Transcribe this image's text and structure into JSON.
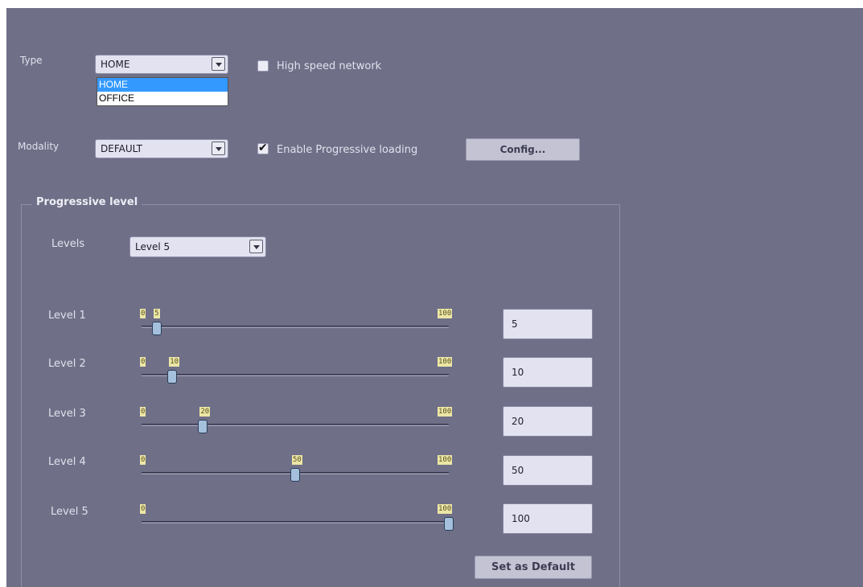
{
  "type": {
    "label": "Type",
    "value": "HOME",
    "options": [
      "HOME",
      "OFFICE"
    ],
    "highlighted": "HOME"
  },
  "high_speed": {
    "label": "High speed network",
    "checked": false
  },
  "modality": {
    "label": "Modality",
    "value": "DEFAULT"
  },
  "progressive_loading": {
    "label": "Enable Progressive loading",
    "checked": true
  },
  "config_button": "Config...",
  "group": {
    "title": "Progressive level",
    "levels_label": "Levels",
    "levels_value": "Level 5",
    "rows": [
      {
        "label": "Level 1",
        "min": 0,
        "max": 100,
        "value": 5,
        "min_text": "0",
        "max_text": "100",
        "value_text": "5",
        "field": "5"
      },
      {
        "label": "Level 2",
        "min": 0,
        "max": 100,
        "value": 10,
        "min_text": "0",
        "max_text": "100",
        "value_text": "10",
        "field": "10"
      },
      {
        "label": "Level 3",
        "min": 0,
        "max": 100,
        "value": 20,
        "min_text": "0",
        "max_text": "100",
        "value_text": "20",
        "field": "20"
      },
      {
        "label": "Level 4",
        "min": 0,
        "max": 100,
        "value": 50,
        "min_text": "0",
        "max_text": "100",
        "value_text": "50",
        "field": "50"
      },
      {
        "label": "Level 5",
        "min": 0,
        "max": 100,
        "value": 100,
        "min_text": "0",
        "max_text": "100",
        "value_text": "100",
        "field": "100"
      }
    ],
    "default_button": "Set as Default"
  }
}
